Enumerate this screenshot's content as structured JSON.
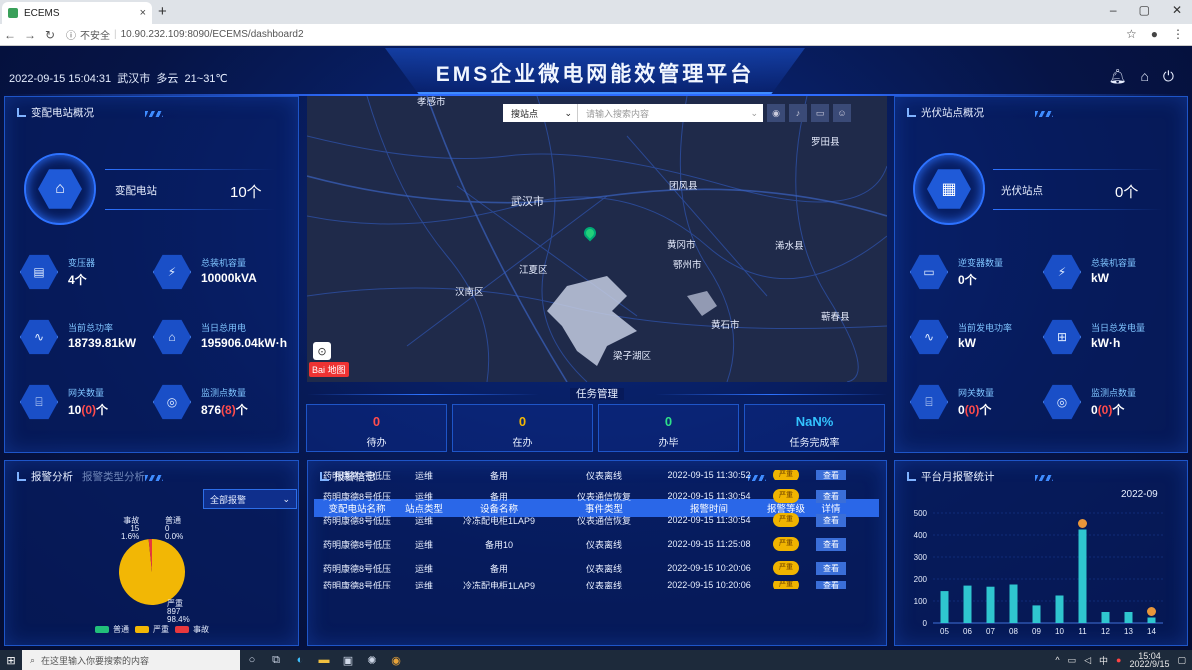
{
  "browser": {
    "tab_title": "ECEMS",
    "tab_close": "×",
    "new_tab": "+",
    "url_security": "不安全",
    "url": "10.90.232.109:8090/ECEMS/dashboard2",
    "window_min": "–",
    "window_max": "▢",
    "window_close": "✕"
  },
  "header": {
    "datetime": "2022-09-15 15:04:31",
    "city": "武汉市",
    "weather": "多云",
    "temp": "21~31℃",
    "title": "EMS企业微电网能效管理平台"
  },
  "substation": {
    "title": "变配电站概况",
    "summary_label": "变配电站",
    "summary_value": "10个",
    "stats": [
      {
        "label": "变压器",
        "value": "4个",
        "icon": "transformer-icon"
      },
      {
        "label": "总装机容量",
        "value": "10000kVA",
        "icon": "capacity-icon"
      },
      {
        "label": "当前总功率",
        "value": "18739.81kW",
        "icon": "power-icon"
      },
      {
        "label": "当日总用电",
        "value": "195906.04kW·h",
        "icon": "energy-icon"
      },
      {
        "label": "网关数量",
        "value_main": "10",
        "value_red": "(0)",
        "value_unit": "个",
        "icon": "gateway-icon"
      },
      {
        "label": "监测点数量",
        "value_main": "876",
        "value_red": "(8)",
        "value_unit": "个",
        "icon": "monitor-point-icon"
      }
    ]
  },
  "pv": {
    "title": "光伏站点概况",
    "summary_label": "光伏站点",
    "summary_value": "0个",
    "stats": [
      {
        "label": "逆变器数量",
        "value": "0个",
        "icon": "inverter-icon"
      },
      {
        "label": "总装机容量",
        "value": "kW",
        "icon": "capacity-icon"
      },
      {
        "label": "当前发电功率",
        "value": "kW",
        "icon": "power-icon"
      },
      {
        "label": "当日总发电量",
        "value": "kW·h",
        "icon": "energy-icon"
      },
      {
        "label": "网关数量",
        "value_main": "0",
        "value_red": "(0)",
        "value_unit": "个",
        "icon": "gateway-icon"
      },
      {
        "label": "监测点数量",
        "value_main": "0",
        "value_red": "(0)",
        "value_unit": "个",
        "icon": "monitor-point-icon"
      }
    ]
  },
  "map": {
    "search_select": "搜站点",
    "search_placeholder": "请输入搜索内容",
    "labels": [
      "孝感市",
      "罗田县",
      "武汉市",
      "团风县",
      "黄冈市",
      "浠水县",
      "江夏区",
      "鄂州市",
      "汉南区",
      "黄石市",
      "蕲春县",
      "梁子湖区"
    ],
    "logo": "Bai 地图"
  },
  "tasks": {
    "title": "任务管理",
    "items": [
      {
        "value": "0",
        "label": "待办",
        "color": "#ff4d4d"
      },
      {
        "value": "0",
        "label": "在办",
        "color": "#f2b705"
      },
      {
        "value": "0",
        "label": "办毕",
        "color": "#2ee08a"
      },
      {
        "value": "NaN%",
        "label": "任务完成率",
        "color": "#33c4ff"
      }
    ]
  },
  "alarm_analysis": {
    "title": "报警分析",
    "subtitle": "报警类型分析",
    "filter": "全部报警",
    "pie_labels": {
      "accident": {
        "name": "事故",
        "count": "15",
        "pct": "1.6%"
      },
      "normal": {
        "name": "普通",
        "count": "0",
        "pct": "0.0%"
      },
      "severe": {
        "name": "严重",
        "count": "897",
        "pct": "98.4%"
      }
    },
    "legend": [
      {
        "name": "普通",
        "color": "#22c07a"
      },
      {
        "name": "严重",
        "color": "#f2b705"
      },
      {
        "name": "事故",
        "color": "#e8383d"
      }
    ],
    "chart_data": {
      "type": "pie",
      "slices": [
        {
          "name": "普通",
          "value": 0,
          "pct": 0.0
        },
        {
          "name": "严重",
          "value": 897,
          "pct": 98.4
        },
        {
          "name": "事故",
          "value": 15,
          "pct": 1.6
        }
      ]
    }
  },
  "alarm_info": {
    "title": "报警信息",
    "columns": [
      "变配电站名称",
      "站点类型",
      "设备名称",
      "事件类型",
      "报警时间",
      "报警等级",
      "详情"
    ],
    "rows": [
      [
        "药明康德8号低压",
        "运维",
        "备用",
        "仪表离线",
        "2022-09-15 11:30:52",
        "严重",
        "查看"
      ],
      [
        "药明康德8号低压",
        "运维",
        "备用",
        "仪表通信恢复",
        "2022-09-15 11:30:54",
        "严重",
        "查看"
      ],
      [
        "药明康德8号低压",
        "运维",
        "冷冻配电柜1LAP9",
        "仪表通信恢复",
        "2022-09-15 11:30:54",
        "严重",
        "查看"
      ],
      [
        "药明康德8号低压",
        "运维",
        "备用10",
        "仪表离线",
        "2022-09-15 11:25:08",
        "严重",
        "查看"
      ],
      [
        "药明康德8号低压",
        "运维",
        "备用",
        "仪表离线",
        "2022-09-15 10:20:06",
        "严重",
        "查看"
      ],
      [
        "药明康德8号低压",
        "运维",
        "冷冻配电柜1LAP9",
        "仪表离线",
        "2022-09-15 10:20:06",
        "严重",
        "查看"
      ]
    ]
  },
  "monthly": {
    "title": "平台月报警统计",
    "year_label": "2022-09",
    "chart_data": {
      "type": "bar",
      "categories": [
        "05",
        "06",
        "07",
        "08",
        "09",
        "10",
        "11",
        "12",
        "13",
        "14"
      ],
      "values": [
        145,
        170,
        165,
        175,
        80,
        125,
        425,
        50,
        50,
        25
      ],
      "yticks": [
        0,
        100,
        200,
        300,
        400,
        500
      ],
      "ylim": [
        0,
        500
      ],
      "markers_on": [
        "11",
        "14"
      ]
    }
  },
  "taskbar": {
    "search_placeholder": "在这里输入你要搜索的内容",
    "time": "15:04",
    "date": "2022/9/15",
    "ime": "中"
  }
}
